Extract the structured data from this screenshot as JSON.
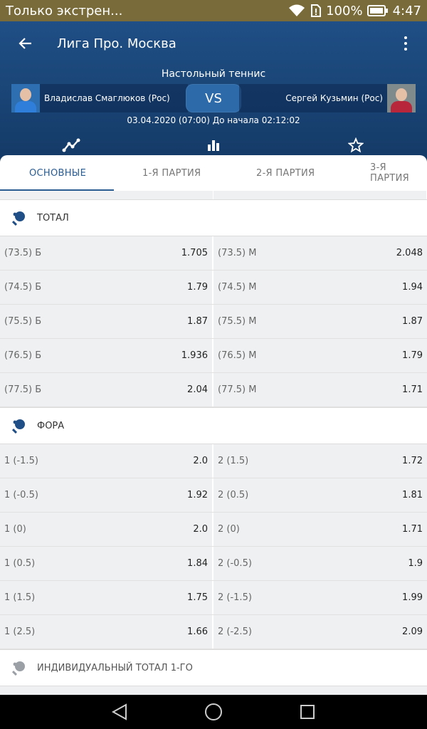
{
  "status_bar": {
    "notification": "Только экстрен...",
    "battery": "100%",
    "time": "4:47"
  },
  "app_bar": {
    "title": "Лига Про. Москва"
  },
  "match": {
    "sport": "Настольный теннис",
    "player1": "Владислав Смаглюков (Рос)",
    "player2": "Сергей Кузьмин (Рос)",
    "vs": "VS",
    "datetime": "03.04.2020 (07:00) До начала 02:12:02"
  },
  "tabs": [
    {
      "label": "ОСНОВНЫЕ"
    },
    {
      "label": "1-Я ПАРТИЯ"
    },
    {
      "label": "2-Я ПАРТИЯ"
    },
    {
      "label": "3-Я ПАРТИЯ"
    }
  ],
  "sections": [
    {
      "title": "ТОТАЛ",
      "rows": [
        {
          "left_label": "(73.5) Б",
          "left_value": "1.705",
          "right_label": "(73.5) М",
          "right_value": "2.048"
        },
        {
          "left_label": "(74.5) Б",
          "left_value": "1.79",
          "right_label": "(74.5) М",
          "right_value": "1.94"
        },
        {
          "left_label": "(75.5) Б",
          "left_value": "1.87",
          "right_label": "(75.5) М",
          "right_value": "1.87"
        },
        {
          "left_label": "(76.5) Б",
          "left_value": "1.936",
          "right_label": "(76.5) М",
          "right_value": "1.79"
        },
        {
          "left_label": "(77.5) Б",
          "left_value": "2.04",
          "right_label": "(77.5) М",
          "right_value": "1.71"
        }
      ]
    },
    {
      "title": "ФОРА",
      "rows": [
        {
          "left_label": "1 (-1.5)",
          "left_value": "2.0",
          "right_label": "2 (1.5)",
          "right_value": "1.72"
        },
        {
          "left_label": "1 (-0.5)",
          "left_value": "1.92",
          "right_label": "2 (0.5)",
          "right_value": "1.81"
        },
        {
          "left_label": "1 (0)",
          "left_value": "2.0",
          "right_label": "2 (0)",
          "right_value": "1.71"
        },
        {
          "left_label": "1 (0.5)",
          "left_value": "1.84",
          "right_label": "2 (-0.5)",
          "right_value": "1.9"
        },
        {
          "left_label": "1 (1.5)",
          "left_value": "1.75",
          "right_label": "2 (-1.5)",
          "right_value": "1.99"
        },
        {
          "left_label": "1 (2.5)",
          "left_value": "1.66",
          "right_label": "2 (-2.5)",
          "right_value": "2.09"
        }
      ]
    },
    {
      "title": "ИНДИВИДУАЛЬНЫЙ ТОТАЛ 1-ГО",
      "rows": []
    }
  ],
  "colors": {
    "header": "#1f4f86",
    "accent": "#2a5b91",
    "statusbar": "#7a6c3a"
  }
}
